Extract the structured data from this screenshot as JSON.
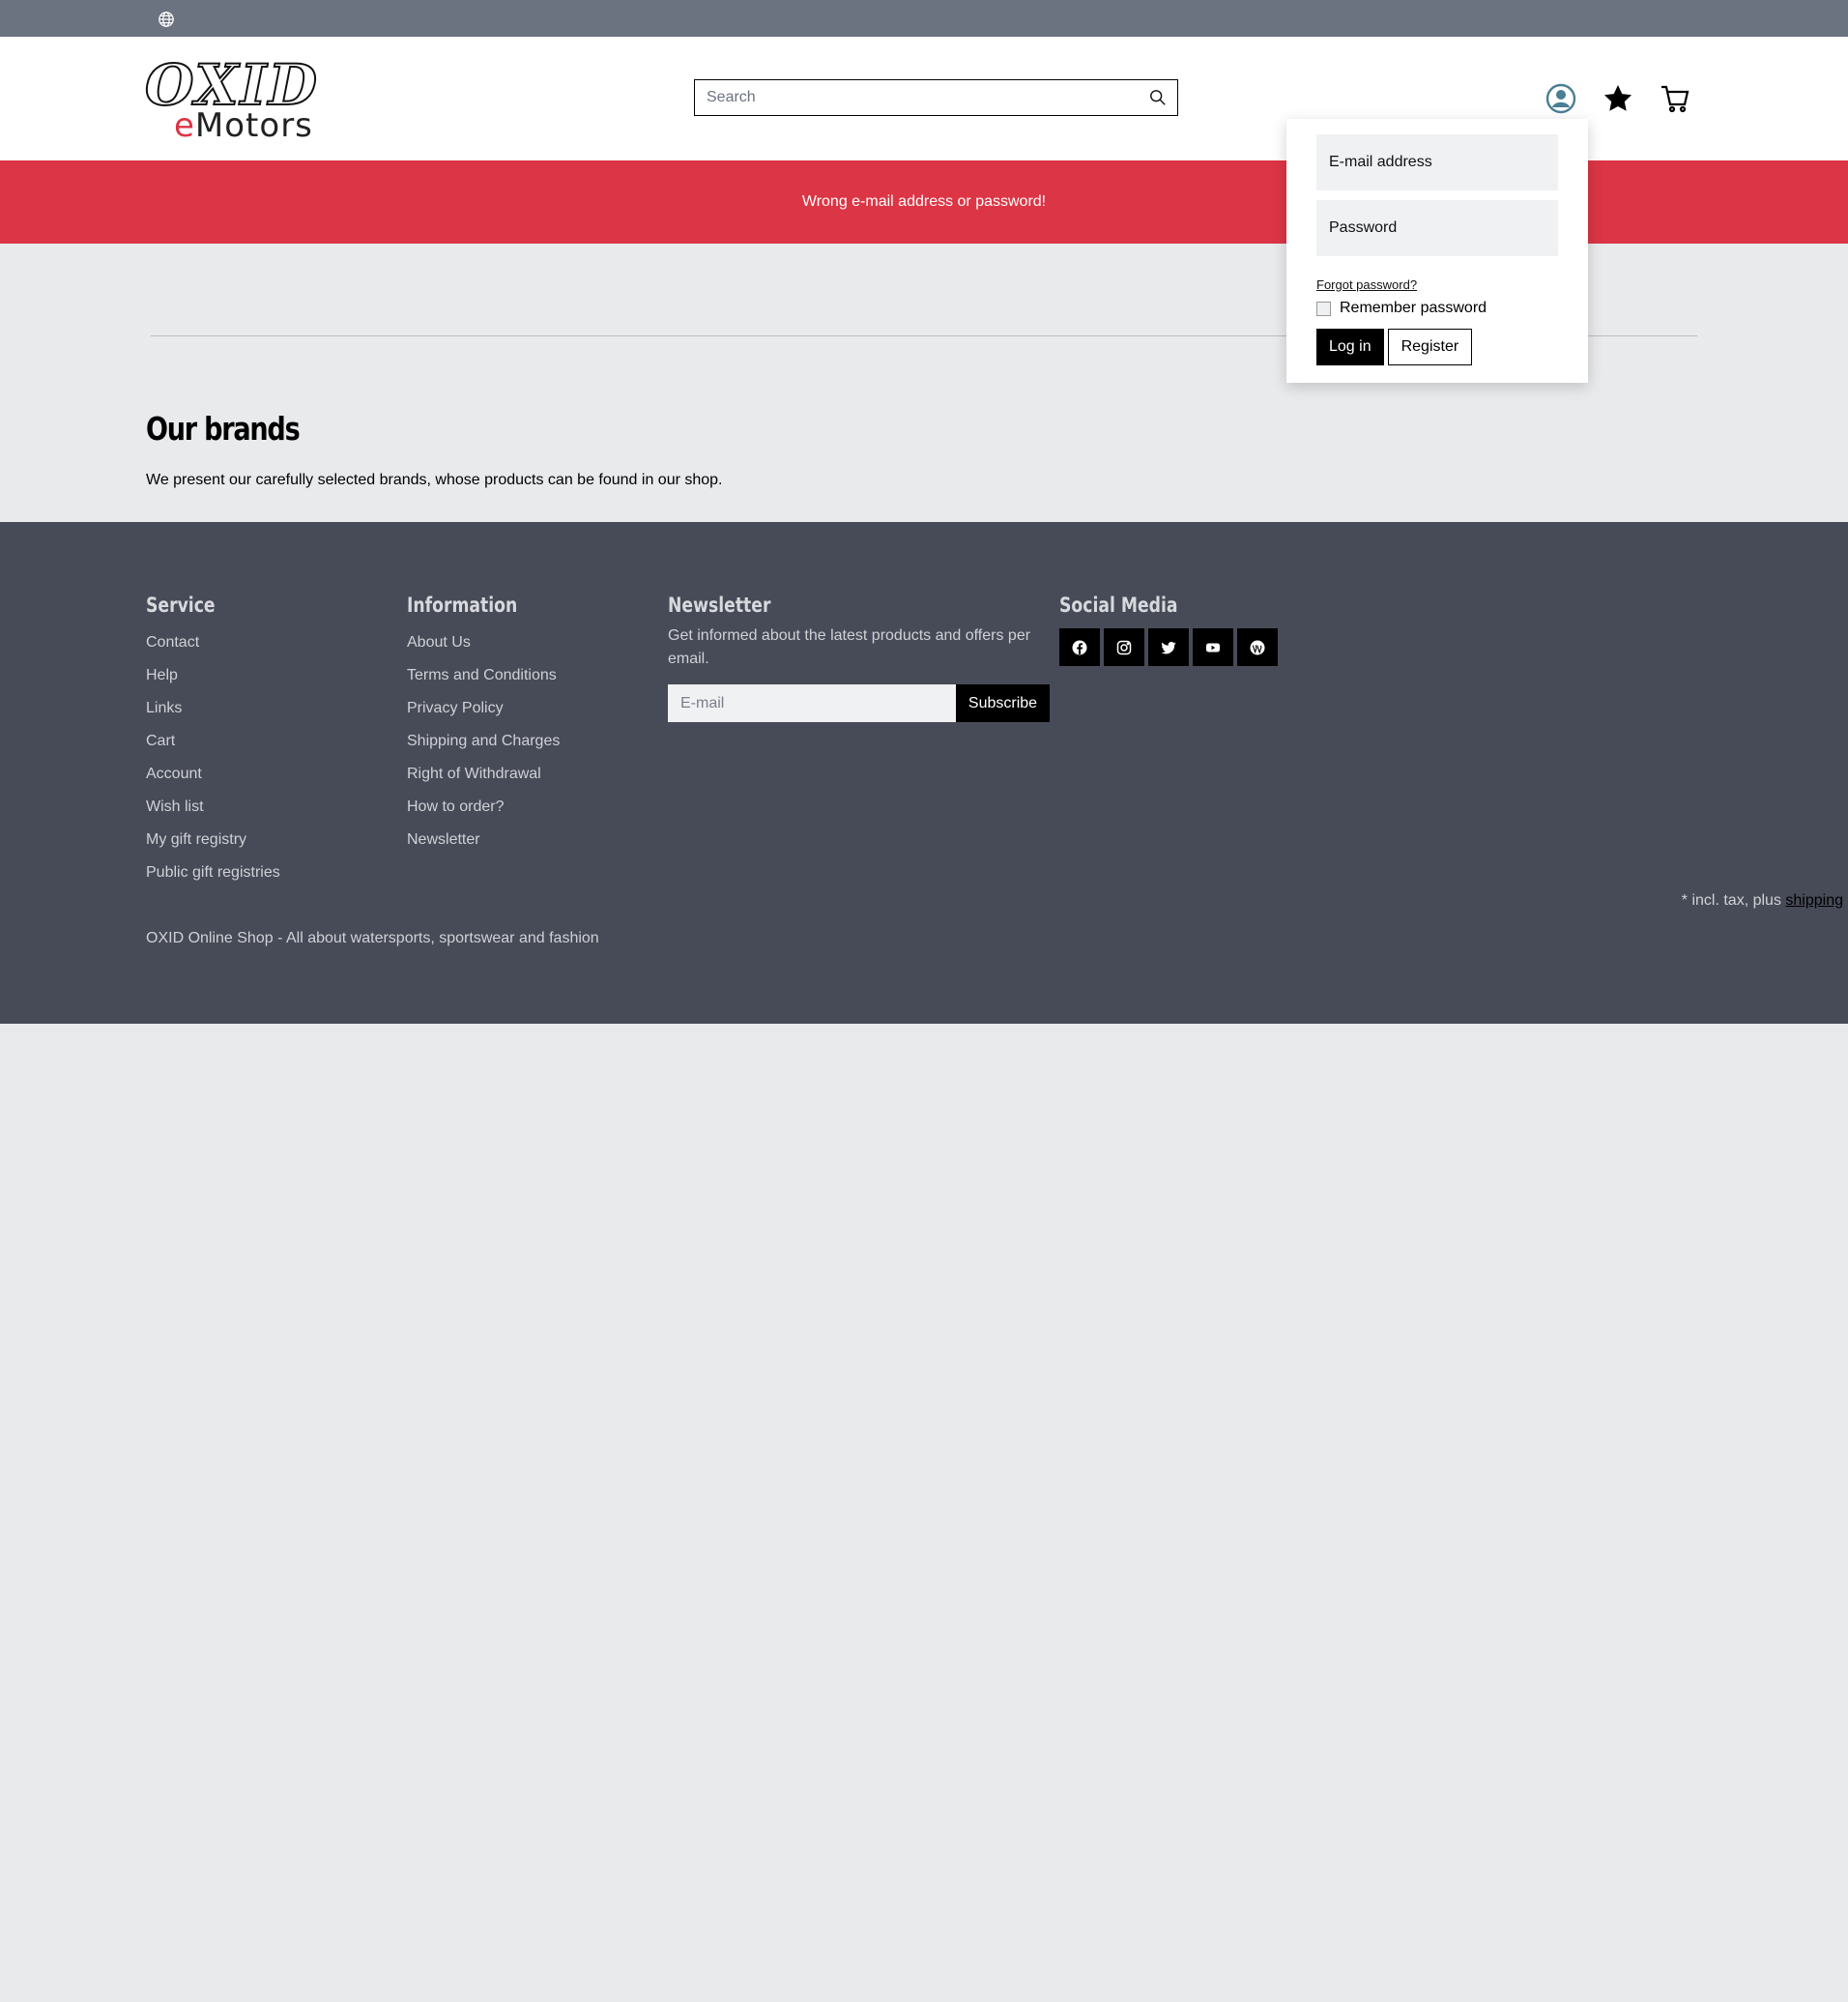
{
  "header": {
    "logo_top": "OXID",
    "logo_bottom_e": "e",
    "logo_bottom_rest": "Motors",
    "search_placeholder": "Search",
    "icons": [
      "globe-icon",
      "search-icon",
      "user-icon",
      "star-icon",
      "cart-icon"
    ],
    "user_icon_color": "#4a7f93"
  },
  "alert": {
    "message": "Wrong e-mail address or password!",
    "color": "#dc3545"
  },
  "login": {
    "email_placeholder": "E-mail address",
    "password_placeholder": "Password",
    "forgot": "Forgot password?",
    "remember": "Remember password",
    "login_button": "Log in",
    "register_button": "Register"
  },
  "main": {
    "title": "Our brands",
    "description": "We present our carefully selected brands, whose products can be found in our shop."
  },
  "footer": {
    "service": {
      "title": "Service",
      "items": [
        "Contact",
        "Help",
        "Links",
        "Cart",
        "Account",
        "Wish list",
        "My gift registry",
        "Public gift registries"
      ]
    },
    "information": {
      "title": "Information",
      "items": [
        "About Us",
        "Terms and Conditions",
        "Privacy Policy",
        "Shipping and Charges",
        "Right of Withdrawal",
        "How to order?",
        "Newsletter"
      ]
    },
    "newsletter": {
      "title": "Newsletter",
      "text": "Get informed about the latest products and offers per email.",
      "email_placeholder": "E-mail",
      "subscribe": "Subscribe"
    },
    "social": {
      "title": "Social Media",
      "icons": [
        "facebook-icon",
        "instagram-icon",
        "twitter-icon",
        "youtube-icon",
        "wordpress-icon"
      ]
    },
    "tax_note": "* incl. tax, plus",
    "tax_link": "shipping",
    "copyright": "OXID Online Shop - All about watersports, sportswear and fashion",
    "background": "#474b57"
  }
}
